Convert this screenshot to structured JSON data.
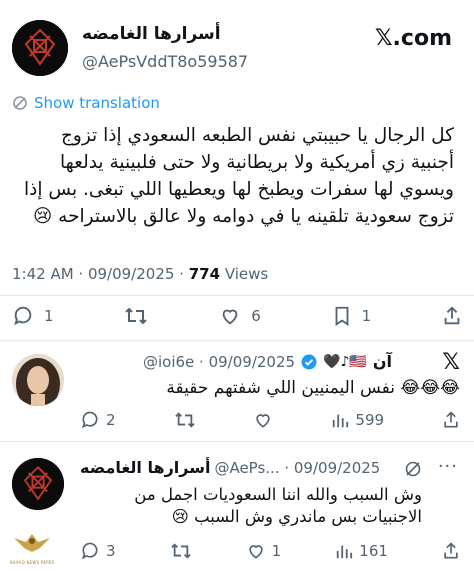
{
  "tweet": {
    "author_name": "أسرارها الغامضه",
    "author_handle": "@AePsVddT8o59587",
    "platform": "𝕏.com",
    "show_translation": "Show translation",
    "text_lines": [
      "كل الرجال يا حبيبتي نفس الطبعه السعودي إذا تزوج",
      "أجنبية زي أمريكية ولا بريطانية ولا حتى فلبينية يدلعها",
      "ويسوي لها سفرات ويطبخ لها ويعطيها اللي تبغى. بس إذا",
      "تزوج سعودية تلقينه يا في دوامه ولا عالق بالاستراحه 😢"
    ],
    "time": "1:42 AM · 09/09/2025 ·",
    "views_count": "774",
    "views_label": "Views",
    "replies": "1",
    "likes": "6",
    "bookmarks": "1"
  },
  "reply1": {
    "name": "آن",
    "emojis": "🇺🇸♪🖤",
    "handle": "@ioi6e · 09/09/2025",
    "text": "😂😂😂 نفس اليمنيين اللي شفتهم حقيقة",
    "replies": "2",
    "views": "599"
  },
  "reply2": {
    "name": "أسرارها الغامضه",
    "handle": "@AePs... · 09/09/2025",
    "text_lines": [
      "وش السبب  والله اننا  السعوديات اجمل من",
      "الاجنبيات بس  ماندري وش السبب 😢"
    ],
    "replies": "3",
    "likes": "1",
    "views": "161"
  },
  "watermark": "AHAAD NEWS PAPER",
  "icons": [
    "reply-icon",
    "retweet-icon",
    "like-icon",
    "bookmark-icon",
    "share-icon",
    "views-icon",
    "translate-icon",
    "grok-icon",
    "x-logo-icon",
    "verified-icon"
  ],
  "colors": {
    "link": "#1d9bf0",
    "secondary": "#536471",
    "verified": "#1d9bf0"
  }
}
